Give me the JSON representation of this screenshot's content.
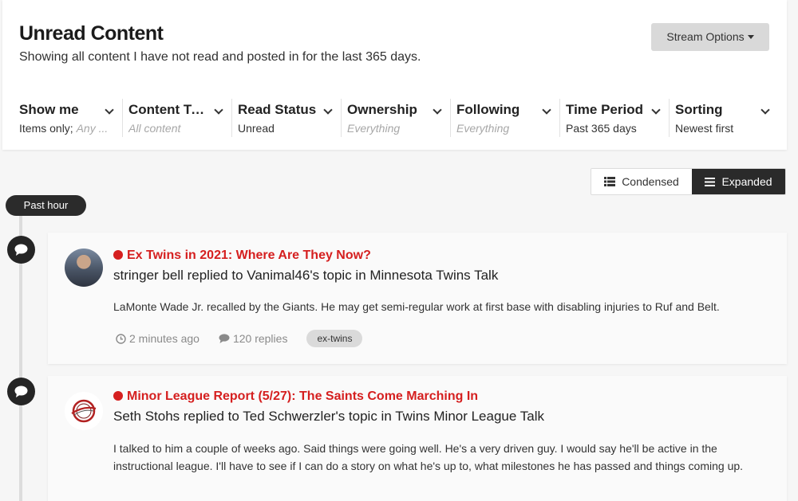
{
  "header": {
    "title": "Unread Content",
    "subtitle": "Showing all content I have not read and posted in for the last 365 days.",
    "stream_options_label": "Stream Options"
  },
  "filters": [
    {
      "label": "Show me",
      "value": "Items only;",
      "value_extra": "Any ..."
    },
    {
      "label": "Content Ty...",
      "value": "All content",
      "muted": true
    },
    {
      "label": "Read Status",
      "value": "Unread"
    },
    {
      "label": "Ownership",
      "value": "Everything",
      "muted": true
    },
    {
      "label": "Following",
      "value": "Everything",
      "muted": true
    },
    {
      "label": "Time Period",
      "value": "Past 365 days"
    },
    {
      "label": "Sorting",
      "value": "Newest first"
    }
  ],
  "view_toggle": {
    "condensed_label": "Condensed",
    "expanded_label": "Expanded",
    "active": "expanded"
  },
  "timeline": {
    "badge": "Past hour"
  },
  "items": [
    {
      "title": "Ex Twins in 2021: Where Are They Now?",
      "meta": "stringer bell replied to Vanimal46's topic in Minnesota Twins Talk",
      "snippet": "LaMonte Wade Jr. recalled by the Giants. He may get semi-regular work at first base with disabling injuries to Ruf and Belt.",
      "time": "2 minutes ago",
      "replies": "120 replies",
      "tag": "ex-twins"
    },
    {
      "title": "Minor League Report (5/27): The Saints Come Marching In",
      "meta": "Seth Stohs replied to Ted Schwerzler's topic in Twins Minor League Talk",
      "snippet": "I talked to him a couple of weeks ago. Said things were going well. He's a very driven guy. I would say he'll be active in the instructional league. I'll have to see if I can do a story on what he's up to, what milestones he has passed and things coming up."
    }
  ],
  "colors": {
    "accent_red": "#d51f1f",
    "dark": "#2a2a2a",
    "button_gray": "#d9d9d9",
    "tag_gray": "#dadada"
  }
}
